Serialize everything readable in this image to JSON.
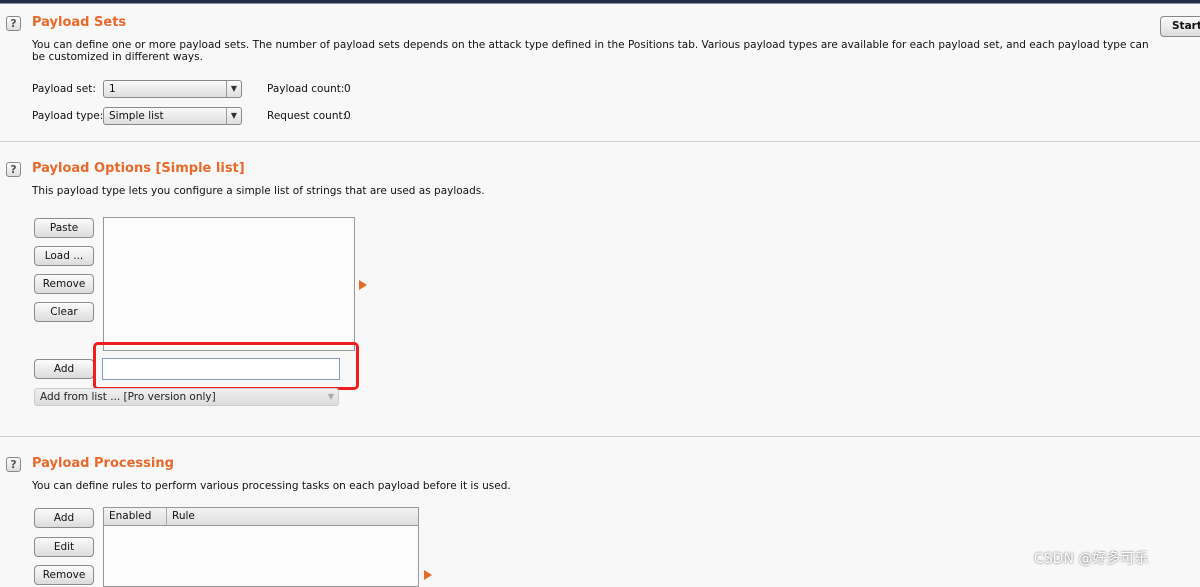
{
  "start_button": "Start attack",
  "sets": {
    "title": "Payload Sets",
    "help": "?",
    "description": "You can define one or more payload sets. The number of payload sets depends on the attack type defined in the Positions tab. Various payload types are available for each payload set, and each payload type can be customized in different ways.",
    "payload_set_label": "Payload set:",
    "payload_set_value": "1",
    "payload_type_label": "Payload type:",
    "payload_type_value": "Simple list",
    "payload_count_label": "Payload count:",
    "payload_count": "0",
    "request_count_label": "Request count:",
    "request_count": "0"
  },
  "options": {
    "title": "Payload Options [Simple list]",
    "help": "?",
    "description": "This payload type lets you configure a simple list of strings that are used as payloads.",
    "buttons": [
      "Paste",
      "Load ...",
      "Remove",
      "Clear"
    ],
    "add": "Add",
    "add_input_value": "",
    "add_from_list": "Add from list ... [Pro version only]"
  },
  "processing": {
    "title": "Payload Processing",
    "help": "?",
    "description": "You can define rules to perform various processing tasks on each payload before it is used.",
    "buttons": [
      "Add",
      "Edit",
      "Remove"
    ],
    "columns": [
      "Enabled",
      "Rule"
    ]
  },
  "highlight_color": "#f01e1e",
  "accent": "#e8692a",
  "watermark": "CSDN @好多可乐"
}
